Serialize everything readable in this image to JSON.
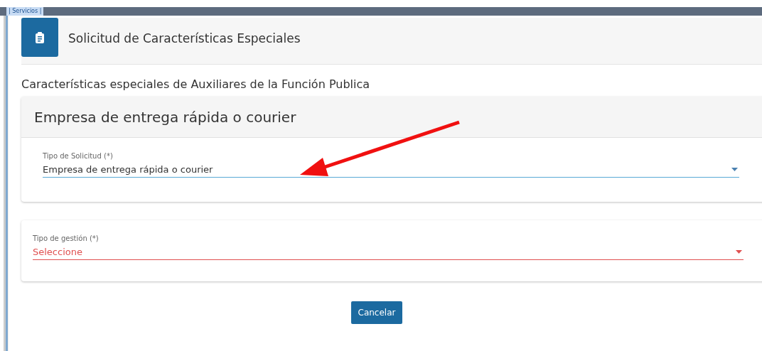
{
  "top_tab": {
    "label": "| Servicios |"
  },
  "header": {
    "title": "Solicitud de Características Especiales"
  },
  "section_title": "Características especiales de Auxiliares de la Función Publica",
  "cards": [
    {
      "title": "Empresa de entrega rápida o courier",
      "field": {
        "label": "Tipo de Solicitud (*)",
        "value": "Empresa de entrega rápida o courier",
        "invalid": false
      }
    },
    {
      "field": {
        "label": "Tipo de gestión (*)",
        "placeholder": "Seleccione",
        "invalid": true
      }
    }
  ],
  "buttons": [
    {
      "label": "Cancelar"
    }
  ],
  "annotation": {
    "kind": "arrow"
  }
}
